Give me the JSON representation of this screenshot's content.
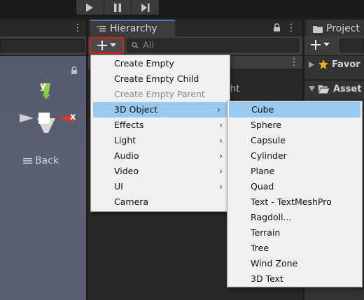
{
  "toolbar": {
    "play_icon": "play-icon",
    "pause_icon": "pause-icon",
    "step_icon": "step-icon"
  },
  "scene": {
    "axis_y": "y",
    "axis_x": "x",
    "back_label": "Back"
  },
  "hierarchy": {
    "title": "Hierarchy",
    "search_placeholder": "All",
    "partial_text": "ht"
  },
  "project": {
    "title": "Project",
    "favorites": "Favor",
    "assets": "Asset"
  },
  "menu": {
    "items": [
      {
        "label": "Create Empty"
      },
      {
        "label": "Create Empty Child"
      },
      {
        "label": "Create Empty Parent",
        "disabled": true
      },
      {
        "label": "3D Object",
        "submenu": true,
        "selected": true
      },
      {
        "label": "Effects",
        "submenu": true
      },
      {
        "label": "Light",
        "submenu": true
      },
      {
        "label": "Audio",
        "submenu": true
      },
      {
        "label": "Video",
        "submenu": true
      },
      {
        "label": "UI",
        "submenu": true
      },
      {
        "label": "Camera"
      }
    ],
    "arrow": "›"
  },
  "submenu": {
    "items": [
      "Cube",
      "Sphere",
      "Capsule",
      "Cylinder",
      "Plane",
      "Quad",
      "Text - TextMeshPro",
      "Ragdoll...",
      "Terrain",
      "Tree",
      "Wind Zone",
      "3D Text"
    ],
    "selected_index": 0
  },
  "colors": {
    "accent": "#3a79bb",
    "highlight_border": "#e01e1e",
    "menu_selected": "#99c9ef"
  }
}
